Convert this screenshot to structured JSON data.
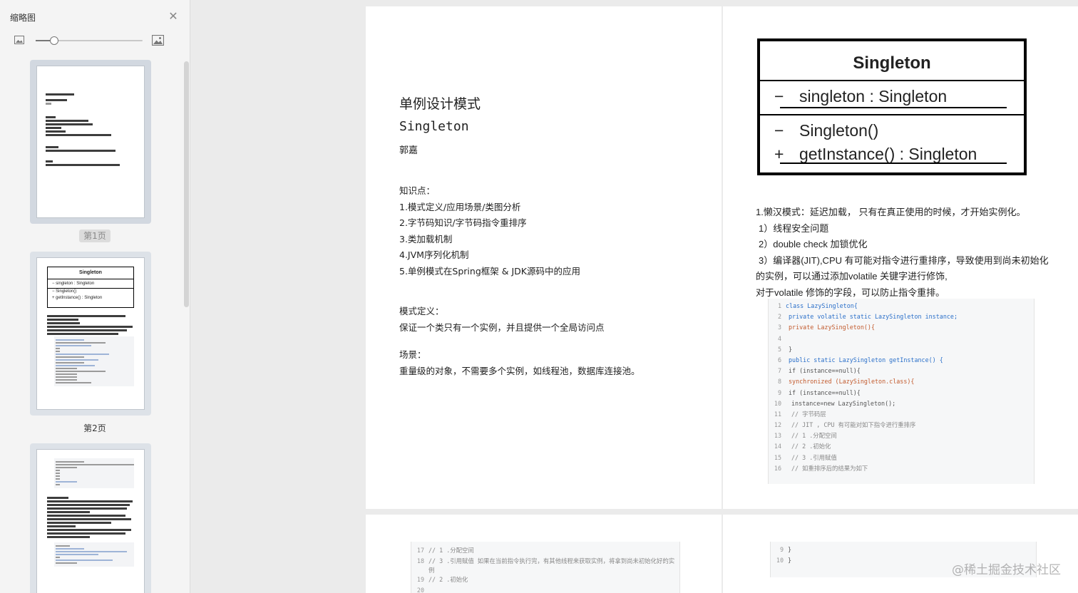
{
  "sidebar": {
    "title": "缩略图",
    "close_icon": "close-icon",
    "zoom": {
      "small_icon": "image-small-icon",
      "large_icon": "image-large-icon",
      "level": 0.17
    },
    "thumbnails": [
      {
        "label": "第1页",
        "selected": true
      },
      {
        "label": "第2页",
        "selected": false
      },
      {
        "label": "",
        "selected": false
      }
    ]
  },
  "page1": {
    "title": "单例设计模式",
    "subtitle": "Singleton",
    "author": "郭嘉",
    "kp_heading": "知识点：",
    "kp_items": [
      "1.模式定义/应用场景/类图分析",
      "2.字节码知识/字节码指令重排序",
      "3.类加载机制",
      "4.JVM序列化机制",
      "5.单例模式在Spring框架 & JDK源码中的应用"
    ],
    "def_heading": "模式定义：",
    "def_text": "保证一个类只有一个实例，并且提供一个全局访问点",
    "scene_heading": "场景：",
    "scene_text": "重量级的对象，不需要多个实例，如线程池，数据库连接池。"
  },
  "page2": {
    "uml": {
      "class_name": "Singleton",
      "field_vis": "−",
      "field": "singleton : Singleton",
      "m1_vis": "−",
      "m1": "Singleton()",
      "m2_vis": "+",
      "m2": "getInstance() : Singleton"
    },
    "lines": [
      "1.懒汉模式：延迟加载， 只有在真正使用的时候，才开始实例化。",
      "1）线程安全问题",
      "2）double check  加锁优化",
      "3）编译器(JIT),CPU 有可能对指令进行重排序，导致使用到尚未初始化",
      "的实例，可以通过添加volatile 关键字进行修饰,",
      "对于volatile 修饰的字段，可以防止指令重排。"
    ],
    "code": [
      {
        "n": "1",
        "t": "class LazySingleton{"
      },
      {
        "n": "2",
        "t": "private volatile static LazySingleton instance;"
      },
      {
        "n": "3",
        "t": "private LazySingleton(){"
      },
      {
        "n": "4",
        "t": ""
      },
      {
        "n": "5",
        "t": "}"
      },
      {
        "n": "6",
        "t": "public static LazySingleton getInstance() {"
      },
      {
        "n": "7",
        "t": "if (instance==null){"
      },
      {
        "n": "8",
        "t": "synchronized (LazySingleton.class){"
      },
      {
        "n": "9",
        "t": "if (instance==null){"
      },
      {
        "n": "10",
        "t": "instance=new LazySingleton();"
      },
      {
        "n": "11",
        "t": "// 字节码层"
      },
      {
        "n": "12",
        "t": "// JIT ,  CPU 有可能对如下指令进行重排序"
      },
      {
        "n": "13",
        "t": "// 1 .分配空间"
      },
      {
        "n": "14",
        "t": "// 2 .初始化"
      },
      {
        "n": "15",
        "t": "// 3 .引用赋值"
      },
      {
        "n": "16",
        "t": "// 如重排序后的结果为如下"
      }
    ]
  },
  "page3": {
    "code": [
      {
        "n": "17",
        "t": "// 1 .分配空间"
      },
      {
        "n": "18",
        "t": "// 3 .引用赋值 如果在当前指令执行完，有其他线程来获取实例，将拿到尚未初始化好的实例"
      },
      {
        "n": "19",
        "t": "// 2 .初始化"
      },
      {
        "n": "20",
        "t": ""
      }
    ]
  },
  "page4": {
    "code": [
      {
        "n": "9",
        "t": "}"
      },
      {
        "n": "10",
        "t": "}"
      }
    ]
  },
  "watermark": "@稀土掘金技术社区"
}
